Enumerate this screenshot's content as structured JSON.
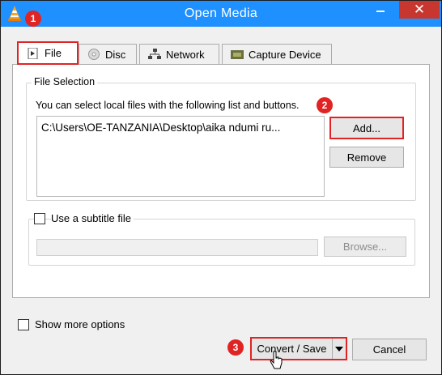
{
  "window": {
    "title": "Open Media",
    "minimize_icon": "minimize-icon",
    "maximize_icon": "maximize-icon",
    "close_glyph": "✕"
  },
  "tabs": [
    {
      "label": "File",
      "icon": "file-icon",
      "active": true
    },
    {
      "label": "Disc",
      "icon": "disc-icon",
      "active": false
    },
    {
      "label": "Network",
      "icon": "network-icon",
      "active": false
    },
    {
      "label": "Capture Device",
      "icon": "capture-device-icon",
      "active": false
    }
  ],
  "file_selection": {
    "title": "File Selection",
    "hint": "You can select local files with the following list and buttons.",
    "files": [
      "C:\\Users\\OE-TANZANIA\\Desktop\\aika ndumi ru..."
    ],
    "add_label": "Add...",
    "remove_label": "Remove"
  },
  "subtitle": {
    "checkbox_label": "Use a subtitle file",
    "checked": false,
    "browse_label": "Browse..."
  },
  "show_more": {
    "label": "Show more options",
    "checked": false
  },
  "actions": {
    "convert_save_label": "Convert / Save",
    "cancel_label": "Cancel"
  },
  "annotations": [
    "1",
    "2",
    "3"
  ],
  "colors": {
    "titlebar": "#1e90ff",
    "close_button": "#c7372f",
    "highlight": "#e02424"
  }
}
